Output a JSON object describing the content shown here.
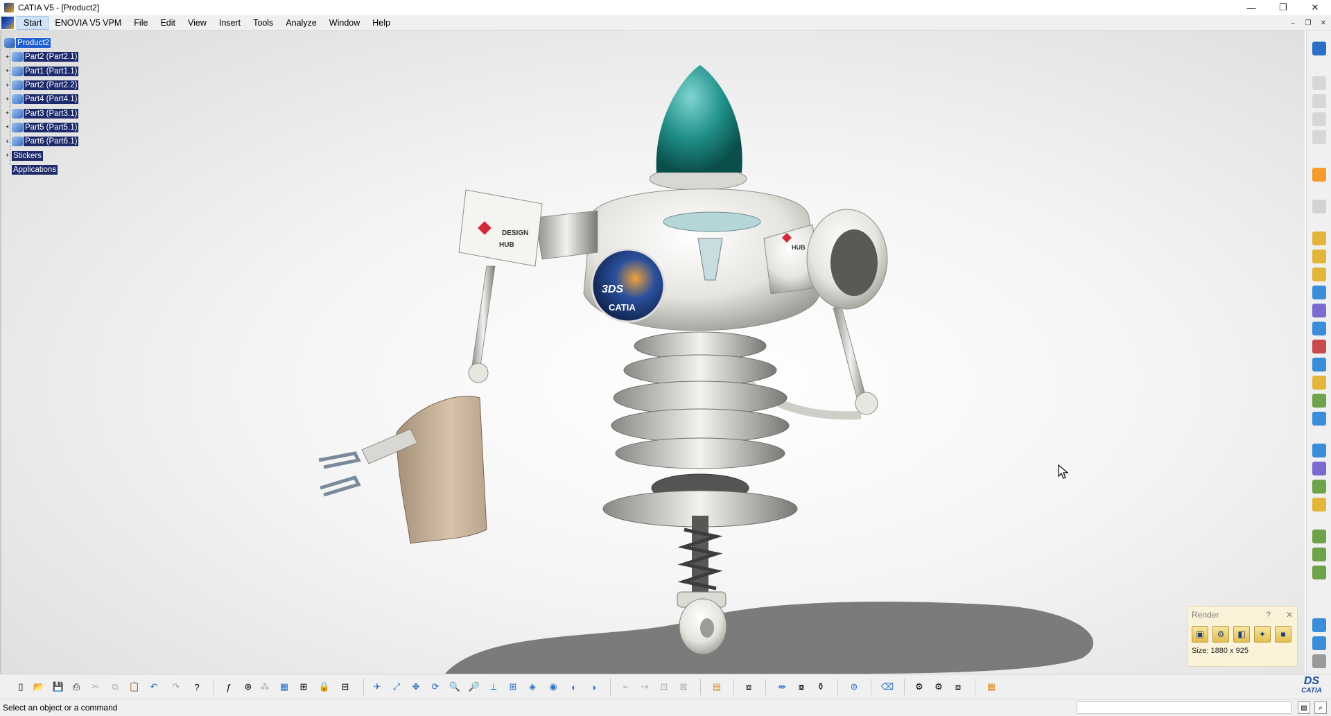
{
  "window": {
    "title": "CATIA V5 - [Product2]",
    "controls": {
      "minimize": "—",
      "restore": "❐",
      "close": "✕"
    }
  },
  "menubar": {
    "items": [
      "Start",
      "ENOVIA V5 VPM",
      "File",
      "Edit",
      "View",
      "Insert",
      "Tools",
      "Analyze",
      "Window",
      "Help"
    ],
    "mdi_controls": {
      "minimize": "–",
      "restore": "❐",
      "close": "✕"
    }
  },
  "tree": {
    "root": "Product2",
    "parts": [
      "Part2 (Part2.1)",
      "Part1 (Part1.1)",
      "Part2 (Part2.2)",
      "Part4 (Part4.1)",
      "Part3 (Part3.1)",
      "Part5 (Part5.1)",
      "Part6 (Part6.1)"
    ],
    "stickers": "Stickers",
    "applications": "Applications",
    "expander": "+"
  },
  "model": {
    "logo_text": "CATIA",
    "logo_ds": "3DS",
    "sticker_design": "DESIGN",
    "sticker_hub": "HUB"
  },
  "render_panel": {
    "title": "Render",
    "help": "?",
    "close": "✕",
    "size_text": "Size: 1880 x 925",
    "tools": [
      "render-shot",
      "render-options",
      "render-scene",
      "render-studio",
      "render-save"
    ]
  },
  "status": {
    "text": "Select an object or a command",
    "command_placeholder": ""
  },
  "brand": {
    "ds": "DS",
    "catia": "CATIA"
  },
  "colors": {
    "tree_label_bg": "#1c2a6b",
    "tree_root_bg": "#1e5fcc",
    "render_panel_bg": "#fbf3d9",
    "dome_color": "#1f8f88"
  }
}
